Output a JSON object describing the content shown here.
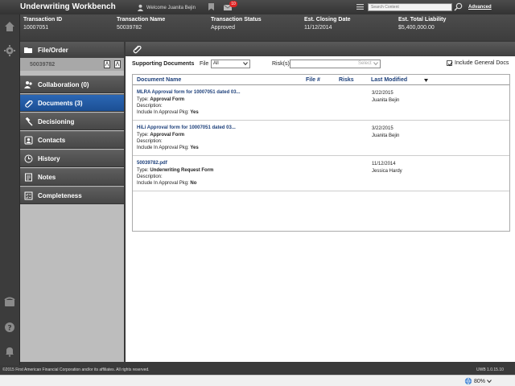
{
  "app": {
    "title": "Underwriting Workbench"
  },
  "header": {
    "welcome": "Welcome Juanita Bejin",
    "notification_count": "10",
    "search_placeholder": "Search Content",
    "advanced_label": "Advanced"
  },
  "summary": {
    "columns": [
      {
        "label": "Transaction ID",
        "value": "10007051"
      },
      {
        "label": "Transaction Name",
        "value": "50039782"
      },
      {
        "label": "Transaction Status",
        "value": "Approved"
      },
      {
        "label": "Est. Closing Date",
        "value": "11/12/2014"
      },
      {
        "label": "Est. Total Liability",
        "value": "$5,400,000.00"
      }
    ]
  },
  "nav": {
    "file_order_label": "File/Order",
    "file_number": "50039782",
    "items": [
      {
        "label": "Collaboration (0)",
        "icon": "collaboration-icon",
        "active": false
      },
      {
        "label": "Documents (3)",
        "icon": "paperclip-icon",
        "active": true
      },
      {
        "label": "Decisioning",
        "icon": "gavel-icon",
        "active": false
      },
      {
        "label": "Contacts",
        "icon": "contacts-icon",
        "active": false
      },
      {
        "label": "History",
        "icon": "clock-icon",
        "active": false
      },
      {
        "label": "Notes",
        "icon": "notes-icon",
        "active": false
      },
      {
        "label": "Completeness",
        "icon": "checklist-icon",
        "active": false
      }
    ]
  },
  "filters": {
    "supporting_label": "Supporting Documents",
    "file_label": "File",
    "file_value": "All",
    "risks_label": "Risk(s)",
    "risks_placeholder": "Select",
    "include_general_label": "Include General Docs",
    "include_general_checked": true
  },
  "grid": {
    "headers": {
      "name": "Document Name",
      "file": "File #",
      "risks": "Risks",
      "modified": "Last Modified"
    },
    "rows": [
      {
        "name": "MLRA Approval form for 10007051 dated 03...",
        "type_label": "Type:",
        "type_value": "Approval Form",
        "desc_label": "Description:",
        "pkg_label": "Include In Approval Pkg:",
        "pkg_value": "Yes",
        "date": "3/22/2015",
        "user": "Juanita Bejin"
      },
      {
        "name": "HiLi Approval form for 10007051 dated 03...",
        "type_label": "Type:",
        "type_value": "Approval Form",
        "desc_label": "Description:",
        "pkg_label": "Include In Approval Pkg:",
        "pkg_value": "Yes",
        "date": "3/22/2015",
        "user": "Juanita Bejin"
      },
      {
        "name": "50039782.pdf",
        "type_label": "Type:",
        "type_value": "Underwriting Request Form",
        "desc_label": "Description:",
        "pkg_label": "Include In Approval Pkg:",
        "pkg_value": "No",
        "date": "11/12/2014",
        "user": "Jessica Hardy"
      }
    ]
  },
  "footer": {
    "copyright": "©2015 First American Financial Corporation and/or its affiliates. All rights reserved.",
    "version": "UWB 1.0.15.10"
  },
  "status": {
    "zoom": "80%"
  },
  "colors": {
    "accent": "#1c4f94",
    "link": "#1c3f7a",
    "badge": "#dd2222"
  }
}
